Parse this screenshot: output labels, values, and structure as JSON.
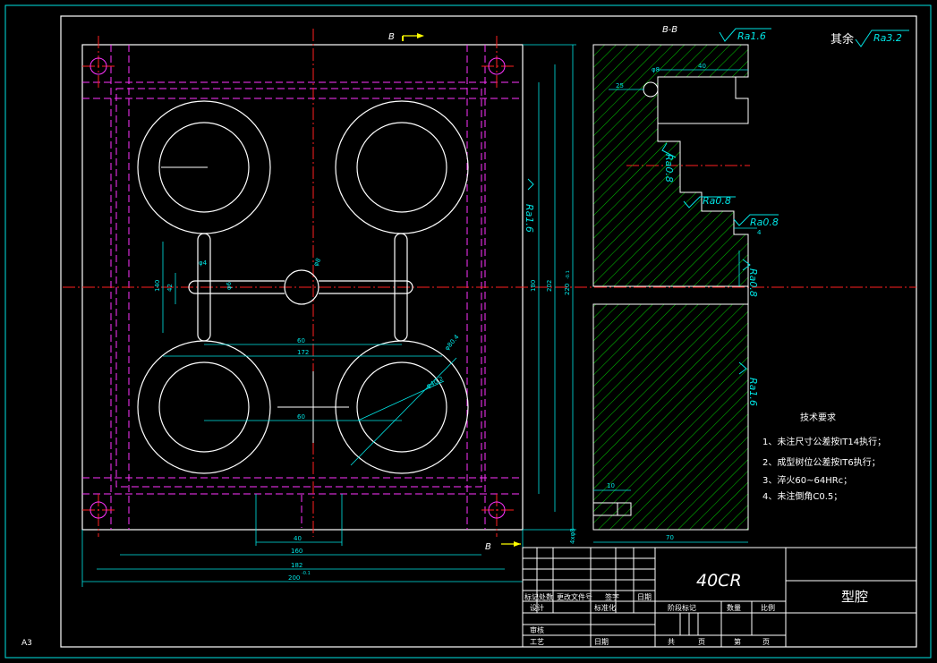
{
  "sheet": {
    "size_label": "A3"
  },
  "section": {
    "label": "B-B",
    "cut_marker_top": "B",
    "cut_marker_bottom": "B"
  },
  "roughness": {
    "general_prefix": "其余",
    "general_value": "Ra3.2",
    "top": "Ra1.6",
    "mid_vertical": "Ra0.8",
    "step_a": "Ra0.8",
    "step_b": "Ra0.8",
    "right_c": "Ra0.8",
    "right_lower": "Ra1.6",
    "front_right": "Ra1.6"
  },
  "dimensions": {
    "w_60": "60",
    "w_40_bottom": "40",
    "w_160": "160",
    "w_182": "182",
    "w_200": "200",
    "w_200_tol": "-0.1",
    "h_140": "140",
    "h_42": "42",
    "d_hole": "φ4",
    "d_runner": "φ6",
    "d_sprue": "φ8",
    "w_60_inner": "60",
    "w_172": "172",
    "h_180": "180",
    "h_202": "202",
    "h_220": "220",
    "h_220_tol": "-0.1",
    "d_cav_1": "φ80.4",
    "d_cav_2": "φ40.2",
    "side_40": "40",
    "side_25": "25",
    "side_70": "70",
    "side_10": "10",
    "side_4": "4",
    "side_d8": "φ8",
    "pin_label": "4xφ8"
  },
  "technical_requirements": {
    "title": "技术要求",
    "items": [
      "1、未注尺寸公差按IT14执行；",
      "2、成型树位公差按IT6执行；",
      "3、淬火60~64HRc；",
      "4、未注倒角C0.5；"
    ]
  },
  "title_block": {
    "material": "40CR",
    "part_name": "型腔",
    "rev_headers": [
      "标记",
      "处数",
      "更改文件号",
      "签字",
      "日期"
    ],
    "design": "设计",
    "standardize": "标准化",
    "review": "审核",
    "process": "工艺",
    "date": "日期",
    "stage_mark": "阶段标记",
    "quantity": "数量",
    "scale": "比例",
    "total": "共",
    "sheets": "页",
    "page_no": "第",
    "page": "页"
  },
  "colors": {
    "frame": "#ffffff",
    "dimension": "#00e5e5",
    "centerline": "#ff2020",
    "hidden": "#ff33ff",
    "hatch": "#00c800",
    "marker": "#ffff00"
  }
}
